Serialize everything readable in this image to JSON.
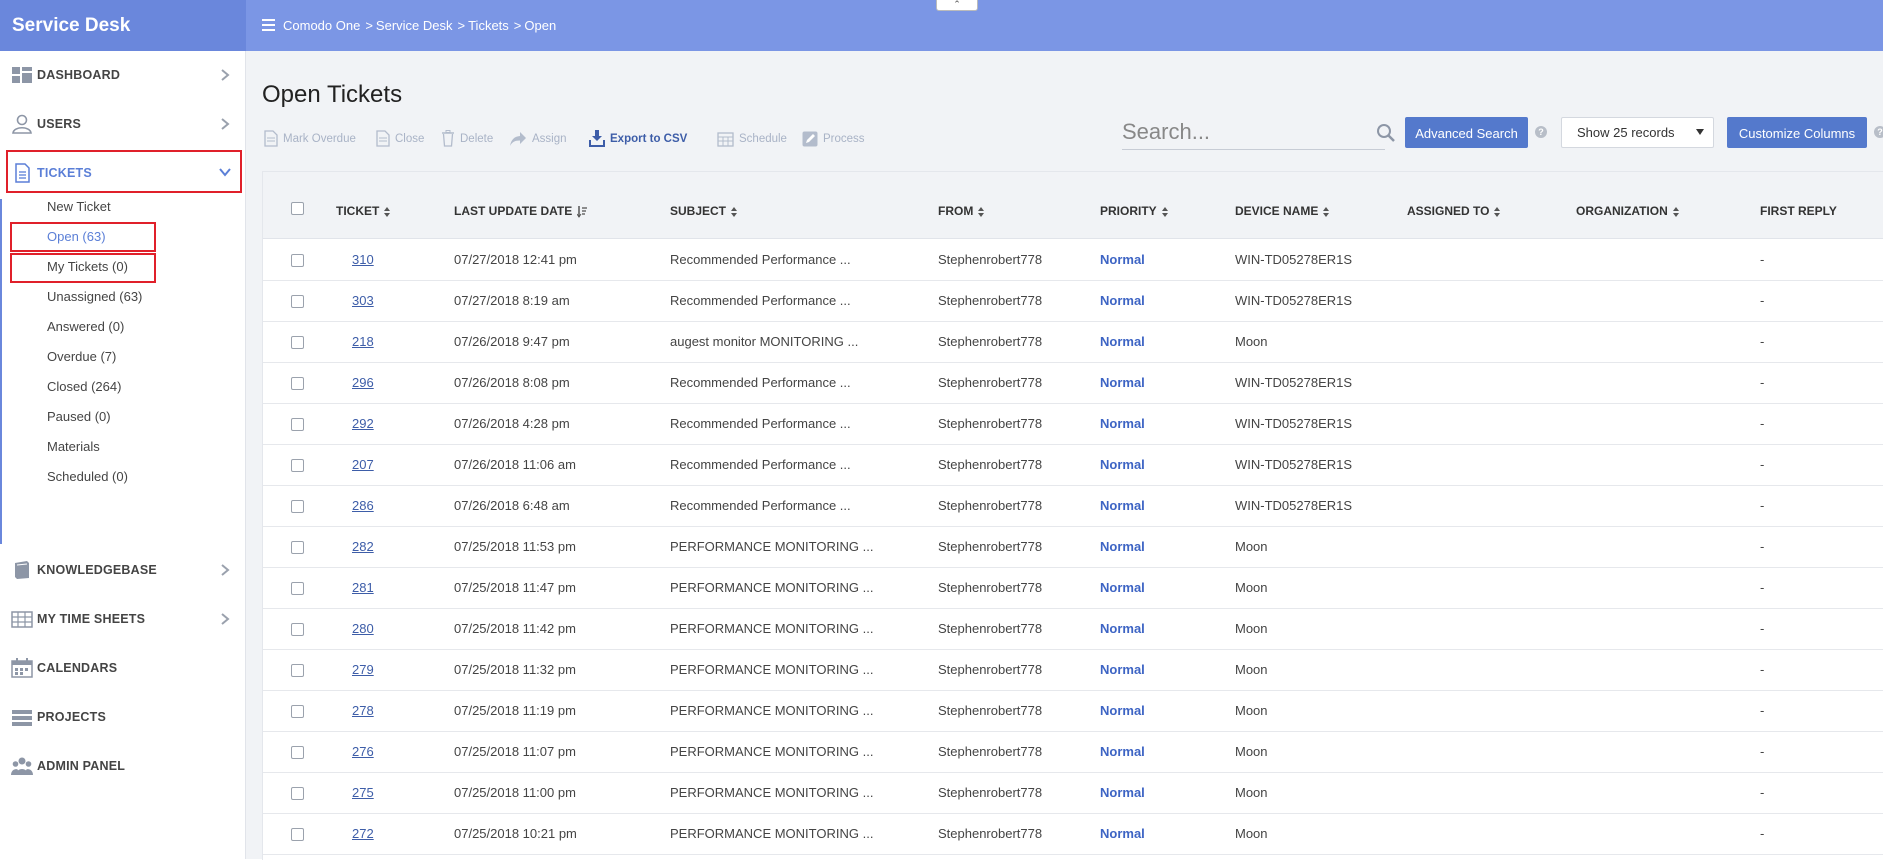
{
  "app": {
    "title": "Service Desk"
  },
  "breadcrumb": [
    "Comodo One",
    "Service Desk",
    "Tickets",
    "Open"
  ],
  "colors": {
    "topbar": "#7b96e5",
    "brand": "#6a87dc",
    "accent": "#5479cc",
    "highlight": "#e0202a"
  },
  "sidebar": {
    "items": [
      {
        "label": "DASHBOARD",
        "icon": "dashboard-icon"
      },
      {
        "label": "USERS",
        "icon": "user-icon"
      },
      {
        "label": "TICKETS",
        "icon": "document-icon"
      },
      {
        "label": "KNOWLEDGEBASE",
        "icon": "book-icon"
      },
      {
        "label": "MY TIME SHEETS",
        "icon": "grid-icon"
      },
      {
        "label": "CALENDARS",
        "icon": "calendar-icon"
      },
      {
        "label": "PROJECTS",
        "icon": "server-icon"
      },
      {
        "label": "ADMIN PANEL",
        "icon": "group-icon"
      }
    ],
    "ticket_sub": [
      "New Ticket",
      "Open (63)",
      "My Tickets (0)",
      "Unassigned (63)",
      "Answered (0)",
      "Overdue (7)",
      "Closed (264)",
      "Paused (0)",
      "Materials",
      "Scheduled (0)"
    ]
  },
  "main": {
    "title": "Open Tickets",
    "toolbar": {
      "mark_overdue": "Mark Overdue",
      "close": "Close",
      "delete": "Delete",
      "assign": "Assign",
      "export_csv": "Export to CSV",
      "schedule": "Schedule",
      "process": "Process"
    },
    "search": {
      "placeholder": "Search..."
    },
    "advanced_search": "Advanced Search",
    "records": "Show 25 records",
    "customize_columns": "Customize Columns"
  },
  "table": {
    "columns": [
      "TICKET",
      "LAST UPDATE DATE",
      "SUBJECT",
      "FROM",
      "PRIORITY",
      "DEVICE NAME",
      "ASSIGNED TO",
      "ORGANIZATION",
      "FIRST REPLY"
    ],
    "rows": [
      {
        "ticket": "310",
        "date": "07/27/2018 12:41 pm",
        "subject": "Recommended Performance ...",
        "from": "Stephenrobert778",
        "priority": "Normal",
        "device": "WIN-TD05278ER1S",
        "first_reply": "-"
      },
      {
        "ticket": "303",
        "date": "07/27/2018 8:19 am",
        "subject": "Recommended Performance ...",
        "from": "Stephenrobert778",
        "priority": "Normal",
        "device": "WIN-TD05278ER1S",
        "first_reply": "-"
      },
      {
        "ticket": "218",
        "date": "07/26/2018 9:47 pm",
        "subject": "augest monitor MONITORING ...",
        "from": "Stephenrobert778",
        "priority": "Normal",
        "device": "Moon",
        "first_reply": "-"
      },
      {
        "ticket": "296",
        "date": "07/26/2018 8:08 pm",
        "subject": "Recommended Performance ...",
        "from": "Stephenrobert778",
        "priority": "Normal",
        "device": "WIN-TD05278ER1S",
        "first_reply": "-"
      },
      {
        "ticket": "292",
        "date": "07/26/2018 4:28 pm",
        "subject": "Recommended Performance ...",
        "from": "Stephenrobert778",
        "priority": "Normal",
        "device": "WIN-TD05278ER1S",
        "first_reply": "-"
      },
      {
        "ticket": "207",
        "date": "07/26/2018 11:06 am",
        "subject": "Recommended Performance ...",
        "from": "Stephenrobert778",
        "priority": "Normal",
        "device": "WIN-TD05278ER1S",
        "first_reply": "-"
      },
      {
        "ticket": "286",
        "date": "07/26/2018 6:48 am",
        "subject": "Recommended Performance ...",
        "from": "Stephenrobert778",
        "priority": "Normal",
        "device": "WIN-TD05278ER1S",
        "first_reply": "-"
      },
      {
        "ticket": "282",
        "date": "07/25/2018 11:53 pm",
        "subject": "PERFORMANCE MONITORING ...",
        "from": "Stephenrobert778",
        "priority": "Normal",
        "device": "Moon",
        "first_reply": "-"
      },
      {
        "ticket": "281",
        "date": "07/25/2018 11:47 pm",
        "subject": "PERFORMANCE MONITORING ...",
        "from": "Stephenrobert778",
        "priority": "Normal",
        "device": "Moon",
        "first_reply": "-"
      },
      {
        "ticket": "280",
        "date": "07/25/2018 11:42 pm",
        "subject": "PERFORMANCE MONITORING ...",
        "from": "Stephenrobert778",
        "priority": "Normal",
        "device": "Moon",
        "first_reply": "-"
      },
      {
        "ticket": "279",
        "date": "07/25/2018 11:32 pm",
        "subject": "PERFORMANCE MONITORING ...",
        "from": "Stephenrobert778",
        "priority": "Normal",
        "device": "Moon",
        "first_reply": "-"
      },
      {
        "ticket": "278",
        "date": "07/25/2018 11:19 pm",
        "subject": "PERFORMANCE MONITORING ...",
        "from": "Stephenrobert778",
        "priority": "Normal",
        "device": "Moon",
        "first_reply": "-"
      },
      {
        "ticket": "276",
        "date": "07/25/2018 11:07 pm",
        "subject": "PERFORMANCE MONITORING ...",
        "from": "Stephenrobert778",
        "priority": "Normal",
        "device": "Moon",
        "first_reply": "-"
      },
      {
        "ticket": "275",
        "date": "07/25/2018 11:00 pm",
        "subject": "PERFORMANCE MONITORING ...",
        "from": "Stephenrobert778",
        "priority": "Normal",
        "device": "Moon",
        "first_reply": "-"
      },
      {
        "ticket": "272",
        "date": "07/25/2018 10:21 pm",
        "subject": "PERFORMANCE MONITORING ...",
        "from": "Stephenrobert778",
        "priority": "Normal",
        "device": "Moon",
        "first_reply": "-"
      }
    ]
  }
}
